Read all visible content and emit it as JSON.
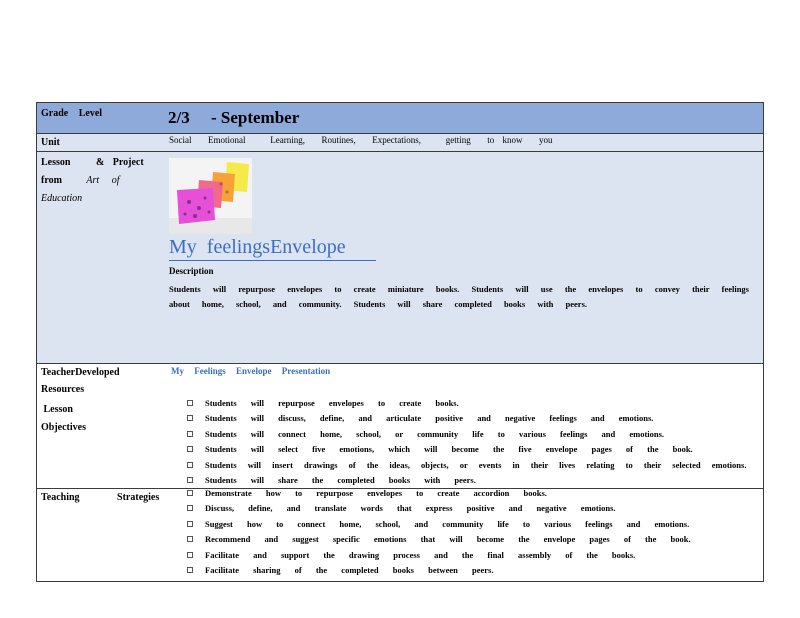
{
  "grade": {
    "label": "Grade   Level",
    "value": "2/3     - September"
  },
  "unit": {
    "label": "Unit",
    "value": "Social  Emotional   Learning,  Routines,  Expectations,   getting  to know  you"
  },
  "lesson": {
    "label_line1": "Lesson   & Project",
    "label_line2_prefix": "from",
    "label_line2_italic": "Art  of",
    "label_line3_italic": "Education",
    "image_alt": "colorful paper envelopes",
    "title": "My  feelingsEnvelope",
    "description_heading": "Description",
    "description": "Students will repurpose envelopes to create miniature books. Students will use the envelopes to convey their feelings about home, school, and community. Students will share completed books with peers."
  },
  "resources": {
    "label_line1": "TeacherDeveloped",
    "label_line2": "Resources",
    "link_text": "My  Feelings  Envelope  Presentation"
  },
  "objectives": {
    "label_line1": " Lesson",
    "label_line2": "Objectives",
    "items": [
      "Students will repurpose envelopes to create books.",
      "Students will discuss, define, and articulate positive and negative feelings and emotions.",
      "Students will connect home, school, or community life to various feelings and emotions.",
      "Students will select five emotions, which will become the five envelope pages of the book.",
      "Students will insert drawings of the ideas, objects, or events in their lives relating to their selected emotions.",
      "Students will share the completed books with peers."
    ]
  },
  "strategies": {
    "label": "Teaching   Strategies",
    "items": [
      "Demonstrate how to repurpose envelopes to create accordion books.",
      "Discuss, define, and translate words that express positive and negative emotions.",
      "Suggest how to connect home, school, and community life to various feelings and emotions.",
      "Recommend and suggest specific emotions that will become the envelope pages of the book.",
      "Facilitate and support the drawing process and the final assembly of the books.",
      "Facilitate sharing of the completed books between peers."
    ]
  },
  "colors": {
    "header_blue": "#8eaadb",
    "light_blue": "#dde4f1",
    "link_blue": "#3b6ec2"
  }
}
